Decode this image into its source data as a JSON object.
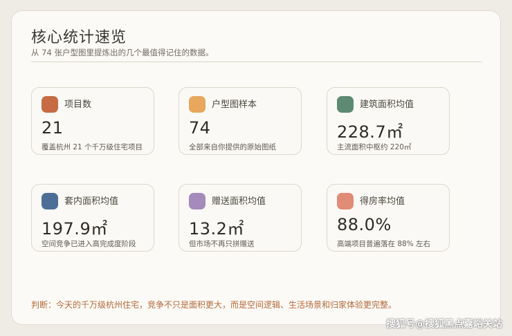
{
  "header": {
    "title": "核心统计速览",
    "subtitle": "从 74 张户型图里提炼出的几个最值得记住的数据。"
  },
  "colors": {
    "projects": "#c76b44",
    "samples": "#e8a75c",
    "building_area": "#5f8a72",
    "inner_area": "#4d6f96",
    "gift_area": "#a48bbb",
    "efficiency": "#e08c77"
  },
  "cards": [
    {
      "label": "项目数",
      "value": "21",
      "note": "覆盖杭州 21 个千万级住宅项目"
    },
    {
      "label": "户型图样本",
      "value": "74",
      "note": "全部来自你提供的原始图纸"
    },
    {
      "label": "建筑面积均值",
      "value": "228.7㎡",
      "note": "主流面积中枢约 220㎡"
    },
    {
      "label": "套内面积均值",
      "value": "197.9㎡",
      "note": "空间竞争已进入高完成度阶段"
    },
    {
      "label": "赠送面积均值",
      "value": "13.2㎡",
      "note": "但市场不再只拼赠送"
    },
    {
      "label": "得房率均值",
      "value": "88.0%",
      "note": "高端项目普遍落在 88% 左右"
    }
  ],
  "footer": {
    "judgement": "判断：今天的千万级杭州住宅，竞争不只是面积更大，而是空间逻辑、生活场景和归家体验更完整。"
  },
  "watermark": "搜狐号@搜狐黑点嘉峪关站"
}
